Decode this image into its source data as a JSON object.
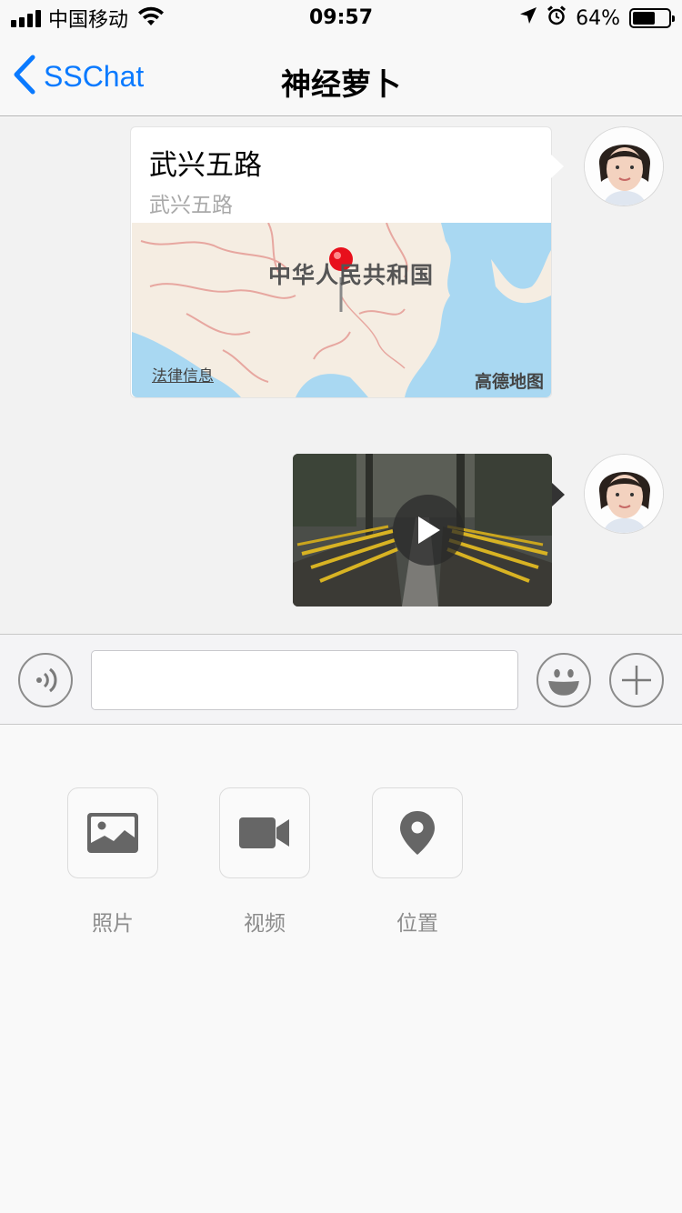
{
  "status_bar": {
    "carrier": "中国移动",
    "time": "09:57",
    "battery_percent": "64%",
    "battery_level": 0.64,
    "icons": [
      "signal-icon",
      "wifi-icon",
      "location-arrow-icon",
      "alarm-icon",
      "battery-icon"
    ]
  },
  "nav": {
    "back_label": "SSChat",
    "title": "神经萝卜"
  },
  "messages": {
    "location": {
      "title": "武兴五路",
      "subtitle": "武兴五路",
      "map_country": "中华人民共和国",
      "map_legal": "法律信息",
      "map_brand": "高德地图"
    },
    "video": {
      "icon": "play-icon"
    }
  },
  "toolbar": {
    "input_value": "",
    "icons": [
      "voice-icon",
      "emoji-icon",
      "plus-icon"
    ]
  },
  "panel": {
    "items": [
      {
        "label": "照片",
        "icon": "photo-icon"
      },
      {
        "label": "视频",
        "icon": "video-camera-icon"
      },
      {
        "label": "位置",
        "icon": "location-pin-icon"
      }
    ]
  },
  "colors": {
    "accent": "#0a7aff",
    "nav_bg": "#f8f8f8",
    "chat_bg": "#f2f2f2",
    "map_water": "#a9d8f2",
    "pin_red": "#e8101c"
  }
}
